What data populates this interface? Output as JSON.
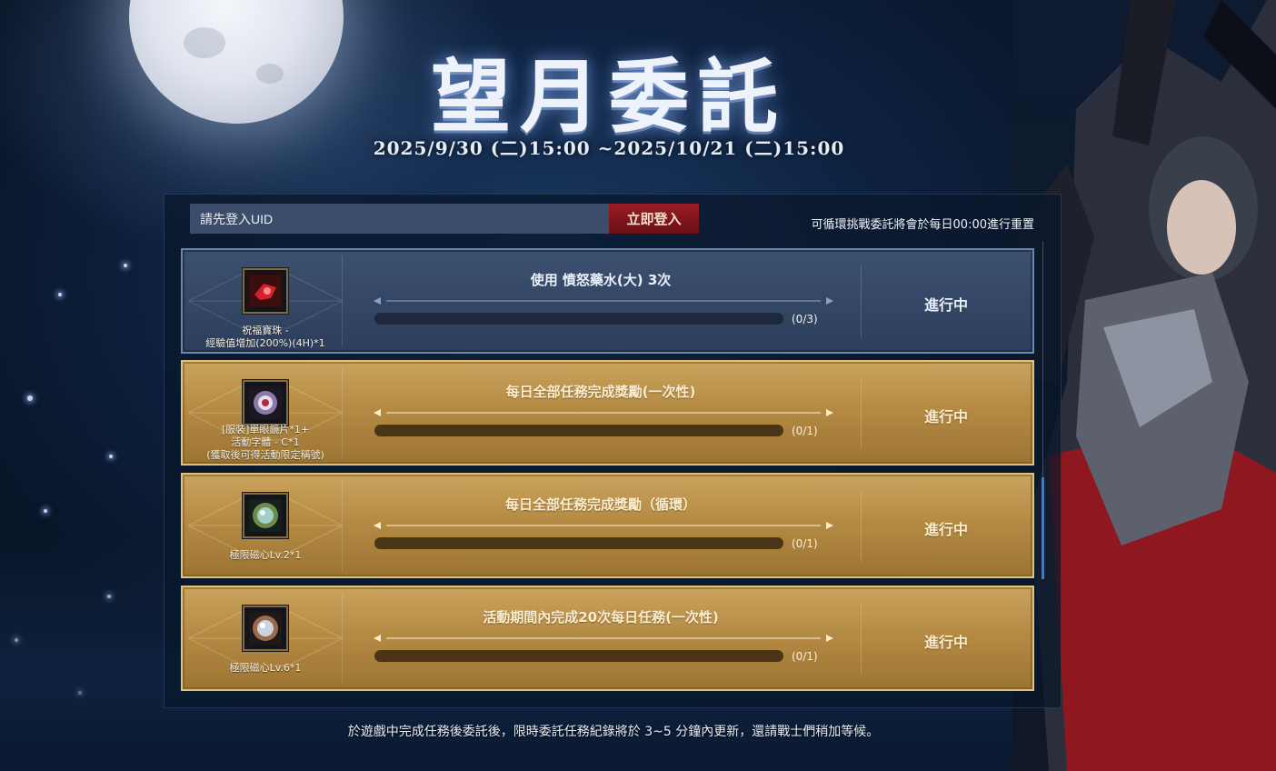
{
  "header": {
    "title": "望月委託",
    "period": "2025/9/30 (二)15:00 ~2025/10/21 (二)15:00"
  },
  "login": {
    "uid_placeholder": "請先登入UID",
    "button_label": "立即登入",
    "reset_note": "可循環挑戰委託將會於每日00:00進行重置"
  },
  "quests": [
    {
      "reward_lines": [
        "祝福寶珠 -",
        "經驗值增加(200%)(4H)*1"
      ],
      "name": "使用 憤怒藥水(大) 3次",
      "count": "(0/3)",
      "progress": 0,
      "status": "進行中",
      "icon": "red-potion-icon"
    },
    {
      "reward_lines": [
        "[服裝]單眼鏡片*1+",
        "活動字體 - C*1",
        "(獲取後可得活動限定稱號)"
      ],
      "name": "每日全部任務完成獎勵(一次性)",
      "count": "(0/1)",
      "progress": 0,
      "status": "進行中",
      "icon": "monocle-icon"
    },
    {
      "reward_lines": [
        "極限磁心Lv.2*1"
      ],
      "name": "每日全部任務完成獎勵（循環）",
      "count": "(0/1)",
      "progress": 0,
      "status": "進行中",
      "icon": "magnetic-core-icon"
    },
    {
      "reward_lines": [
        "極限磁心Lv.6*1"
      ],
      "name": "活動期間內完成20次每日任務(一次性)",
      "count": "(0/1)",
      "progress": 0,
      "status": "進行中",
      "icon": "magnetic-core-icon"
    }
  ],
  "footer": {
    "note": "於遊戲中完成任務後委託後，限時委託任務紀錄將於 3~5 分鐘內更新，還請戰士們稍加等候。"
  },
  "colors": {
    "active_row": "#3c5070",
    "gold_row": "#b58b44",
    "login_button": "#9a1c24"
  }
}
